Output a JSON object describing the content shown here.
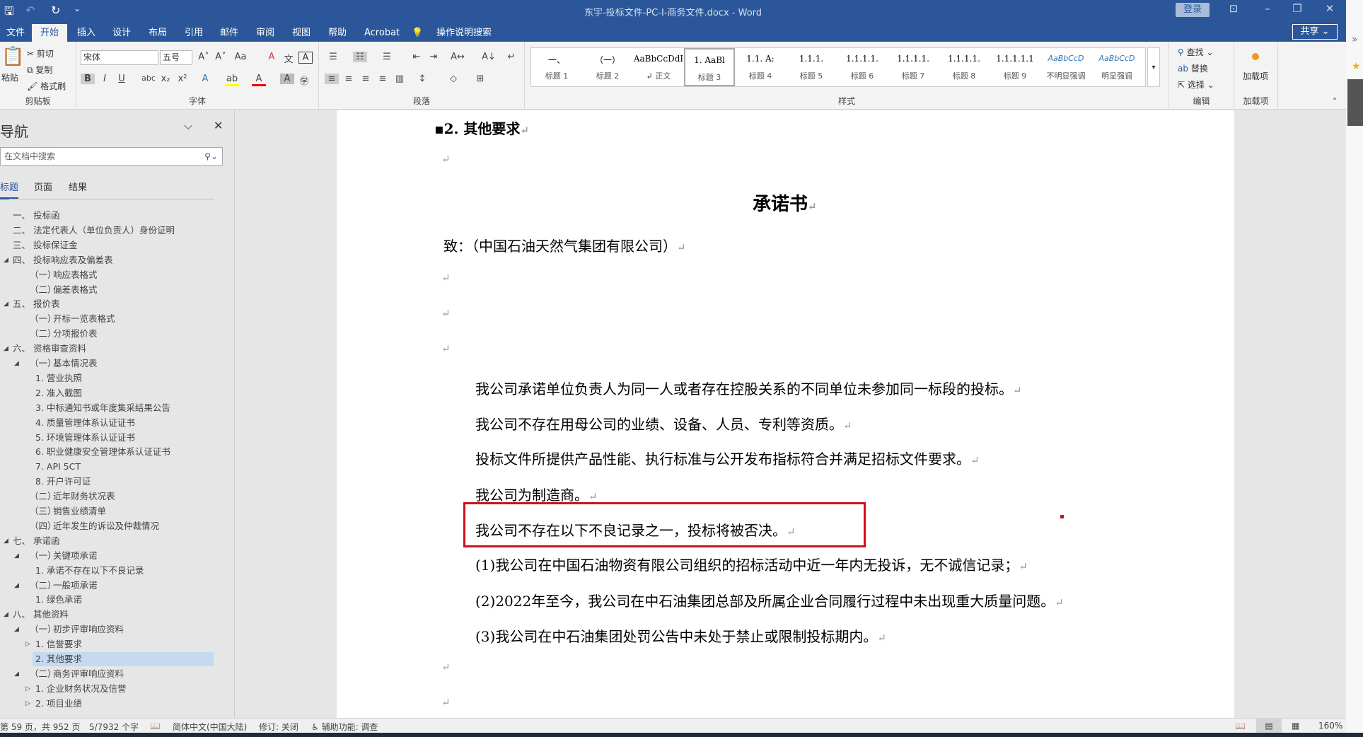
{
  "titlebar": {
    "title": "东宇-投标文件-PC-I-商务文件.docx  -  Word",
    "login": "登录",
    "qa_save": "🖫",
    "qa_undo": "↶",
    "qa_redo": "↻",
    "qa_more": "⌄"
  },
  "tabs": [
    "文件",
    "开始",
    "插入",
    "设计",
    "布局",
    "引用",
    "邮件",
    "审阅",
    "视图",
    "帮助",
    "Acrobat",
    "操作说明搜索"
  ],
  "share": "共享",
  "ribbon": {
    "clipboard": {
      "label": "剪贴板",
      "paste": "粘贴",
      "cut": "剪切",
      "copy": "复制",
      "painter": "格式刷"
    },
    "font": {
      "label": "字体",
      "font_name": "宋体",
      "font_size": "五号"
    },
    "paragraph": {
      "label": "段落"
    },
    "styles": {
      "label": "样式",
      "items": [
        {
          "preview": "一、",
          "name": "标题 1"
        },
        {
          "preview": "（一）",
          "name": "标题 2"
        },
        {
          "preview": "AaBbCcDdI",
          "name": "↲ 正文"
        },
        {
          "preview": "1.  AaBl",
          "name": "标题 3"
        },
        {
          "preview": "1.1.  A:",
          "name": "标题 4"
        },
        {
          "preview": "1.1.1.",
          "name": "标题 5"
        },
        {
          "preview": "1.1.1.1.",
          "name": "标题 6"
        },
        {
          "preview": "1.1.1.1.",
          "name": "标题 7"
        },
        {
          "preview": "1.1.1.1.",
          "name": "标题 8"
        },
        {
          "preview": "1.1.1.1.1",
          "name": "标题 9"
        },
        {
          "preview": "AaBbCcD",
          "name": "不明显强调"
        },
        {
          "preview": "AaBbCcD",
          "name": "明显强调"
        }
      ]
    },
    "editing": {
      "label": "编辑",
      "find": "查找",
      "replace": "替换",
      "select": "选择"
    },
    "addins": {
      "label": "加载项",
      "button": "加载项"
    }
  },
  "nav": {
    "title": "导航",
    "search_placeholder": "在文档中搜索",
    "tabs": [
      "标题",
      "页面",
      "结果"
    ],
    "items": [
      {
        "num": "一、",
        "text": "投标函",
        "lvl": 1,
        "arrow": ""
      },
      {
        "num": "二、",
        "text": "法定代表人（单位负责人）身份证明",
        "lvl": 1,
        "arrow": ""
      },
      {
        "num": "三、",
        "text": "投标保证金",
        "lvl": 1,
        "arrow": ""
      },
      {
        "num": "四、",
        "text": "投标响应表及偏差表",
        "lvl": 1,
        "arrow": "◢"
      },
      {
        "num": "（一）",
        "text": "响应表格式",
        "lvl": 2,
        "arrow": ""
      },
      {
        "num": "（二）",
        "text": "偏差表格式",
        "lvl": 2,
        "arrow": ""
      },
      {
        "num": "五、",
        "text": "报价表",
        "lvl": 1,
        "arrow": "◢"
      },
      {
        "num": "（一）",
        "text": "开标一览表格式",
        "lvl": 2,
        "arrow": ""
      },
      {
        "num": "（二）",
        "text": "分项报价表",
        "lvl": 2,
        "arrow": ""
      },
      {
        "num": "六、",
        "text": "资格审查资料",
        "lvl": 1,
        "arrow": "◢"
      },
      {
        "num": "（一）",
        "text": "基本情况表",
        "lvl": 2,
        "arrow": "◢"
      },
      {
        "num": "",
        "text": "1. 营业执照",
        "lvl": 3,
        "arrow": ""
      },
      {
        "num": "",
        "text": "2. 准入截图",
        "lvl": 3,
        "arrow": ""
      },
      {
        "num": "",
        "text": "3. 中标通知书或年度集采结果公告",
        "lvl": 3,
        "arrow": ""
      },
      {
        "num": "",
        "text": "4. 质量管理体系认证证书",
        "lvl": 3,
        "arrow": ""
      },
      {
        "num": "",
        "text": "5. 环境管理体系认证证书",
        "lvl": 3,
        "arrow": ""
      },
      {
        "num": "",
        "text": "6. 职业健康安全管理体系认证证书",
        "lvl": 3,
        "arrow": ""
      },
      {
        "num": "",
        "text": "7. API 5CT",
        "lvl": 3,
        "arrow": ""
      },
      {
        "num": "",
        "text": "8. 开户许可证",
        "lvl": 3,
        "arrow": ""
      },
      {
        "num": "（二）",
        "text": "近年财务状况表",
        "lvl": 2,
        "arrow": ""
      },
      {
        "num": "（三）",
        "text": "销售业绩清单",
        "lvl": 2,
        "arrow": ""
      },
      {
        "num": "（四）",
        "text": "近年发生的诉讼及仲裁情况",
        "lvl": 2,
        "arrow": ""
      },
      {
        "num": "七、",
        "text": "承诺函",
        "lvl": 1,
        "arrow": "◢"
      },
      {
        "num": "（一）",
        "text": "关键项承诺",
        "lvl": 2,
        "arrow": "◢"
      },
      {
        "num": "",
        "text": "1. 承诺不存在以下不良记录",
        "lvl": 3,
        "arrow": ""
      },
      {
        "num": "（二）",
        "text": "一般项承诺",
        "lvl": 2,
        "arrow": "◢"
      },
      {
        "num": "",
        "text": "1. 绿色承诺",
        "lvl": 3,
        "arrow": ""
      },
      {
        "num": "八、",
        "text": "其他资料",
        "lvl": 1,
        "arrow": "◢"
      },
      {
        "num": "（一）",
        "text": "初步评审响应资料",
        "lvl": 2,
        "arrow": "◢"
      },
      {
        "num": "",
        "text": "1. 信誉要求",
        "lvl": 3,
        "arrow": "▷"
      },
      {
        "num": "",
        "text": "2. 其他要求",
        "lvl": 3,
        "arrow": "",
        "selected": true
      },
      {
        "num": "（二）",
        "text": "商务评审响应资料",
        "lvl": 2,
        "arrow": "◢"
      },
      {
        "num": "",
        "text": "1. 企业财务状况及信誉",
        "lvl": 3,
        "arrow": "▷"
      },
      {
        "num": "",
        "text": "2. 项目业绩",
        "lvl": 3,
        "arrow": "▷"
      }
    ]
  },
  "doc": {
    "heading": "2. 其他要求",
    "title": "承诺书",
    "to": "致：（中国石油天然气集团有限公司）",
    "mark": "↵",
    "paras": [
      "我公司承诺单位负责人为同一人或者存在控股关系的不同单位未参加同一标段的投标。",
      "我公司不存在用母公司的业绩、设备、人员、专利等资质。",
      "投标文件所提供产品性能、执行标准与公开发布指标符合并满足招标文件要求。",
      "我公司为制造商。",
      "我公司不存在以下不良记录之一，投标将被否决。",
      "(1)我公司在中国石油物资有限公司组织的招标活动中近一年内无投诉，无不诚信记录；",
      "(2)2022年至今，我公司在中石油集团总部及所属企业合同履行过程中未出现重大质量问题。",
      "(3)我公司在中石油集团处罚公告中未处于禁止或限制投标期内。"
    ]
  },
  "status": {
    "page": "第 59 页，共 952 页",
    "words": "5/7932 个字",
    "lang": "简体中文(中国大陆)",
    "track": "修订: 关闭",
    "access": "辅助功能: 调查",
    "zoom": "160%"
  },
  "colors": {
    "accent": "#2b579a",
    "highlight_box": "#d0101c"
  }
}
